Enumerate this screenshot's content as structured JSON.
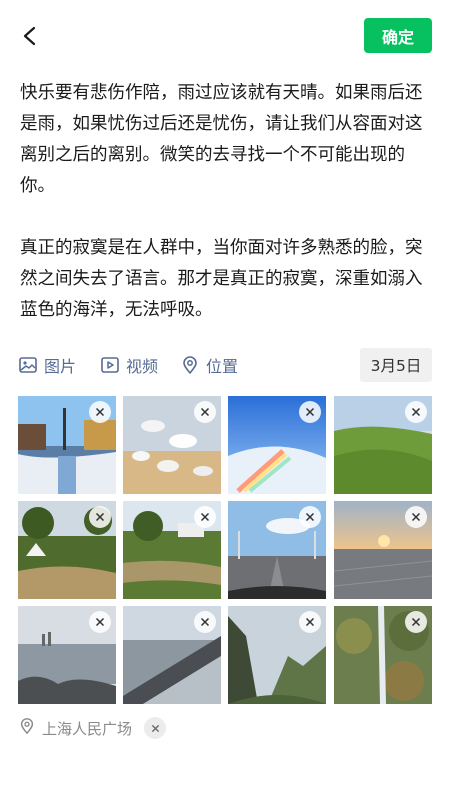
{
  "header": {
    "back_icon": "chevron-left-icon",
    "confirm_label": "确定",
    "accent": "#07c160"
  },
  "post": {
    "paragraphs": [
      "快乐要有悲伤作陪，雨过应该就有天晴。如果雨后还是雨，如果忧伤过后还是忧伤，请让我们从容面对这离别之后的离别。微笑的去寻找一个不可能出现的你。",
      "真正的寂寞是在人群中，当你面对许多熟悉的脸，突然之间失去了语言。那才是真正的寂寞，深重如溺入蓝色的海洋，无法呼吸。"
    ]
  },
  "toolbar": {
    "image_label": "图片",
    "video_label": "视频",
    "location_label": "位置",
    "date_label": "3月5日",
    "link_color": "#576b95"
  },
  "photos": [
    {
      "name": "photo-snowy-street",
      "remove_icon": "close-icon"
    },
    {
      "name": "photo-seagulls",
      "remove_icon": "close-icon"
    },
    {
      "name": "photo-rainbow-clouds",
      "remove_icon": "close-icon"
    },
    {
      "name": "photo-green-grassland",
      "remove_icon": "close-icon"
    },
    {
      "name": "photo-camp-river",
      "remove_icon": "close-icon"
    },
    {
      "name": "photo-park-canal",
      "remove_icon": "close-icon"
    },
    {
      "name": "photo-bridge-road",
      "remove_icon": "close-icon"
    },
    {
      "name": "photo-sunset-plaza",
      "remove_icon": "close-icon"
    },
    {
      "name": "photo-lake-rocks",
      "remove_icon": "close-icon"
    },
    {
      "name": "photo-breakwater",
      "remove_icon": "close-icon"
    },
    {
      "name": "photo-mountain-valley",
      "remove_icon": "close-icon"
    },
    {
      "name": "photo-waterfall",
      "remove_icon": "close-icon"
    }
  ],
  "location": {
    "icon": "location-pin-icon",
    "text": "上海人民广场",
    "clear_icon": "close-icon"
  }
}
